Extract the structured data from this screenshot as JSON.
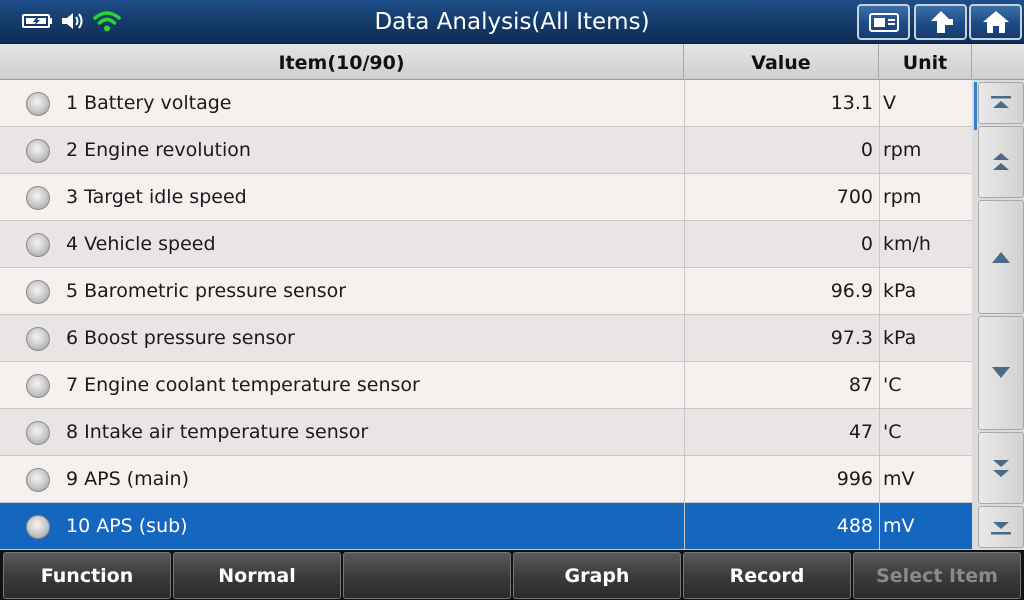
{
  "window": {
    "title": "Data Analysis(All Items)"
  },
  "status_icons": [
    "battery-charging-icon",
    "speaker-icon",
    "wifi-icon"
  ],
  "toolbar_icons": [
    "screenshot-icon",
    "back-icon",
    "home-icon"
  ],
  "table": {
    "headers": {
      "item": "Item(10/90)",
      "value": "Value",
      "unit": "Unit"
    },
    "rows": [
      {
        "item": "1 Battery voltage",
        "value": "13.1",
        "unit": "V"
      },
      {
        "item": "2 Engine revolution",
        "value": "0",
        "unit": "rpm"
      },
      {
        "item": "3 Target idle speed",
        "value": "700",
        "unit": "rpm"
      },
      {
        "item": "4 Vehicle speed",
        "value": "0",
        "unit": "km/h"
      },
      {
        "item": "5 Barometric pressure sensor",
        "value": "96.9",
        "unit": "kPa"
      },
      {
        "item": "6 Boost pressure sensor",
        "value": "97.3",
        "unit": "kPa"
      },
      {
        "item": "7 Engine coolant temperature sensor",
        "value": "87",
        "unit": "'C"
      },
      {
        "item": "8 Intake air temperature sensor",
        "value": "47",
        "unit": "'C"
      },
      {
        "item": "9 APS (main)",
        "value": "996",
        "unit": "mV"
      },
      {
        "item": "10 APS (sub)",
        "value": "488",
        "unit": "mV"
      }
    ],
    "selected_row": 10
  },
  "scroll_buttons": [
    "scroll-top-icon",
    "page-up-icon",
    "line-up-icon",
    "line-down-icon",
    "page-down-icon",
    "scroll-bottom-icon"
  ],
  "bottom_bar": {
    "buttons": [
      {
        "label": "Function",
        "enabled": true
      },
      {
        "label": "Normal",
        "enabled": true
      },
      {
        "label": "",
        "enabled": true
      },
      {
        "label": "Graph",
        "enabled": true
      },
      {
        "label": "Record",
        "enabled": true
      },
      {
        "label": "Select Item",
        "enabled": false
      }
    ]
  },
  "colors": {
    "titlebar": "#163d6e",
    "selected_row": "#1466bf",
    "row_odd": "#f6f0ef",
    "row_even": "#e9e5e5",
    "wifi": "#2bd62b"
  }
}
